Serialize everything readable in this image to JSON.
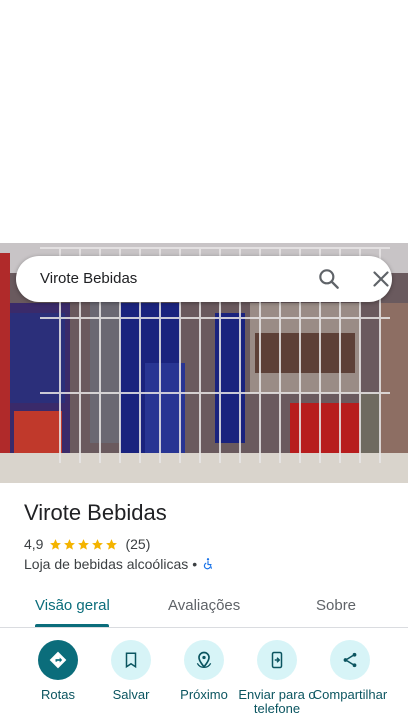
{
  "search": {
    "query": "Virote Bebidas"
  },
  "place": {
    "name": "Virote Bebidas",
    "rating": "4,9",
    "stars": 5,
    "review_count": "(25)",
    "category": "Loja de bebidas alcoólicas",
    "separator": "•"
  },
  "tabs": [
    {
      "label": "Visão geral",
      "active": true
    },
    {
      "label": "Avaliações",
      "active": false
    },
    {
      "label": "Sobre",
      "active": false
    }
  ],
  "actions": [
    {
      "label": "Rotas",
      "icon": "directions-icon"
    },
    {
      "label": "Salvar",
      "icon": "bookmark-icon"
    },
    {
      "label": "Próximo",
      "icon": "nearby-icon"
    },
    {
      "label": "Enviar para o telefone",
      "icon": "send-to-phone-icon"
    },
    {
      "label": "Compartilhar",
      "icon": "share-icon"
    }
  ],
  "colors": {
    "accent": "#0b6d7b",
    "action_bg": "#d7f4f7",
    "star": "#f4b400",
    "wheelchair": "#1a73e8"
  }
}
